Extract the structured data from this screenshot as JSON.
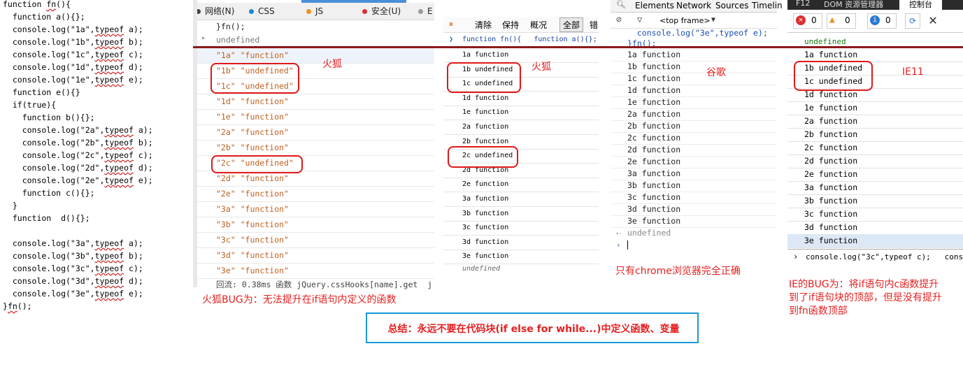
{
  "code": {
    "lines": [
      {
        "t": "function ",
        "k": "fn",
        "r": "(){"
      },
      {
        "t": "  function a(){};"
      },
      {
        "t": "  console.log(\"1a\",",
        "k": "typeof",
        "r": " a);"
      },
      {
        "t": "  console.log(\"1b\",",
        "k": "typeof",
        "r": " b);"
      },
      {
        "t": "  console.log(\"1c\",",
        "k": "typeof",
        "r": " c);"
      },
      {
        "t": "  console.log(\"1d\",",
        "k": "typeof",
        "r": " d);"
      },
      {
        "t": "  console.log(\"1e\",",
        "k": "typeof",
        "r": " e);"
      },
      {
        "t": "  function e(){}"
      },
      {
        "t": "  if(true){"
      },
      {
        "t": "    function b(){};"
      },
      {
        "t": "    console.log(\"2a\",",
        "k": "typeof",
        "r": " a);"
      },
      {
        "t": "    console.log(\"2b\",",
        "k": "typeof",
        "r": " b);"
      },
      {
        "t": "    console.log(\"2c\",",
        "k": "typeof",
        "r": " c);"
      },
      {
        "t": "    console.log(\"2d\",",
        "k": "typeof",
        "r": " d);"
      },
      {
        "t": "    console.log(\"2e\",",
        "k": "typeof",
        "r": " e);"
      },
      {
        "t": "    function c(){};"
      },
      {
        "t": "  }"
      },
      {
        "t": "  function  d(){};"
      },
      {
        "t": ""
      },
      {
        "t": "  console.log(\"3a\",",
        "k": "typeof",
        "r": " a);"
      },
      {
        "t": "  console.log(\"3b\",",
        "k": "typeof",
        "r": " b);"
      },
      {
        "t": "  console.log(\"3c\",",
        "k": "typeof",
        "r": " c);"
      },
      {
        "t": "  console.log(\"3d\",",
        "k": "typeof",
        "r": " d);"
      },
      {
        "t": "  console.log(\"3e\",",
        "k": "typeof",
        "r": " e);"
      },
      {
        "t": "}",
        "k": "fn",
        "r": "();"
      }
    ]
  },
  "firefox1": {
    "tabs": [
      {
        "label": "网络(N)",
        "color": "#444444"
      },
      {
        "label": "CSS",
        "color": "#1a8ad0"
      },
      {
        "label": "JS",
        "color": "#f09020"
      },
      {
        "label": "安全(U)",
        "color": "#e03030"
      },
      {
        "label": "E",
        "color": "#999999"
      }
    ],
    "pre_lines": [
      "}fn();",
      "undefined"
    ],
    "rows": [
      "\"1a\" \"function\"",
      "\"1b\" \"undefined\"",
      "\"1c\" \"undefined\"",
      "\"1d\" \"function\"",
      "\"1e\" \"function\"",
      "\"2a\" \"function\"",
      "\"2b\" \"function\"",
      "\"2c\" \"undefined\"",
      "\"2d\" \"function\"",
      "\"2e\" \"function\"",
      "\"3a\" \"function\"",
      "\"3b\" \"function\"",
      "\"3c\" \"function\"",
      "\"3d\" \"function\"",
      "\"3e\" \"function\""
    ],
    "footer": "回流: 0.38ms 函数 jQuery.cssHooks[name].get  j",
    "label": "火狐",
    "bug_note": "火狐BUG为：无法提升在if语句内定义的函数"
  },
  "firefox2": {
    "toolbar": [
      "清除",
      "保持",
      "概况",
      "全部",
      "错"
    ],
    "input_line": "function fn(){   function a(){};",
    "rows": [
      "1a function",
      "1b undefined",
      "1c undefined",
      "1d function",
      "1e function",
      "2a function",
      "2b function",
      "2c undefined",
      "2d function",
      "2e function",
      "3a function",
      "3b function",
      "3c function",
      "3d function",
      "3e function"
    ],
    "last": "undefined",
    "label": "火狐"
  },
  "chrome": {
    "tabs": [
      "Elements",
      "Network",
      "Sources",
      "Timelin"
    ],
    "frame": "<top frame>",
    "top_lines": [
      "  console.log(\"3e\",typeof e);",
      "}fn();"
    ],
    "rows": [
      "1a function",
      "1b function",
      "1c function",
      "1d function",
      "1e function",
      "2a function",
      "2b function",
      "2c function",
      "2d function",
      "2e function",
      "3a function",
      "3b function",
      "3c function",
      "3d function",
      "3e function"
    ],
    "undef": "undefined",
    "label": "谷歌",
    "note": "只有chrome浏览器完全正确"
  },
  "ie": {
    "tabs": [
      "F12",
      "DOM 资源管理器",
      "控制台"
    ],
    "counts": {
      "error": "0",
      "warn": "0",
      "info": "0"
    },
    "undef": "undefined",
    "rows": [
      "1a function",
      "1b undefined",
      "1c undefined",
      "1d function",
      "1e function",
      "2a function",
      "2b function",
      "2c function",
      "2d function",
      "2e function",
      "3a function",
      "3b function",
      "3c function",
      "3d function",
      "3e function"
    ],
    "input": "console.log(\"3c\",typeof c);   cons",
    "label": "IE11",
    "bug_note": [
      "IE的BUG为：将if语句内c函数提升",
      "到了if语句块的顶部，但是没有提升",
      "到fn函数顶部"
    ]
  },
  "summary": "总结：永远不要在代码块(if else for while...)中定义函数、变量",
  "colors": {
    "annotation": "#e52020",
    "divider": "#8b1a1a",
    "summary_border": "#1a9ad8"
  }
}
